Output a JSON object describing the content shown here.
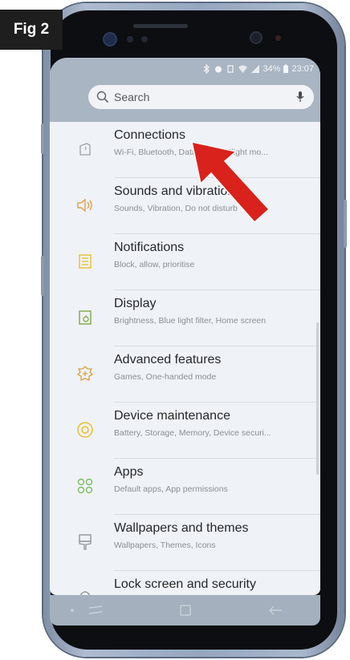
{
  "figure_label": "Fig 2",
  "status_bar": {
    "battery": "34%",
    "time": "23:07"
  },
  "search": {
    "placeholder": "Search"
  },
  "settings": [
    {
      "title": "Connections",
      "subtitle": "Wi-Fi, Bluetooth, Data usage, Flight mo...",
      "icon": "connections-icon",
      "color": "#9aa1a8"
    },
    {
      "title": "Sounds and vibration",
      "subtitle": "Sounds, Vibration, Do not disturb",
      "icon": "speaker-icon",
      "color": "#e0a14e"
    },
    {
      "title": "Notifications",
      "subtitle": "Block, allow, prioritise",
      "icon": "notifications-icon",
      "color": "#e8c23a"
    },
    {
      "title": "Display",
      "subtitle": "Brightness, Blue light filter, Home screen",
      "icon": "display-icon",
      "color": "#7fa945"
    },
    {
      "title": "Advanced features",
      "subtitle": "Games, One-handed mode",
      "icon": "advanced-features-icon",
      "color": "#d9a042"
    },
    {
      "title": "Device maintenance",
      "subtitle": "Battery, Storage, Memory, Device securi...",
      "icon": "device-maintenance-icon",
      "color": "#e6c02c"
    },
    {
      "title": "Apps",
      "subtitle": "Default apps, App permissions",
      "icon": "apps-icon",
      "color": "#7cbf63"
    },
    {
      "title": "Wallpapers and themes",
      "subtitle": "Wallpapers, Themes, Icons",
      "icon": "wallpapers-icon",
      "color": "#8f969d"
    },
    {
      "title": "Lock screen and security",
      "subtitle": "",
      "icon": "lock-icon",
      "color": "#8f969d"
    }
  ],
  "colors": {
    "arrow": "#d9221c",
    "fig_label_bg": "#1e1e1e",
    "screen_bg": "#eff2f6",
    "header_bg": "#a9b5c2"
  }
}
